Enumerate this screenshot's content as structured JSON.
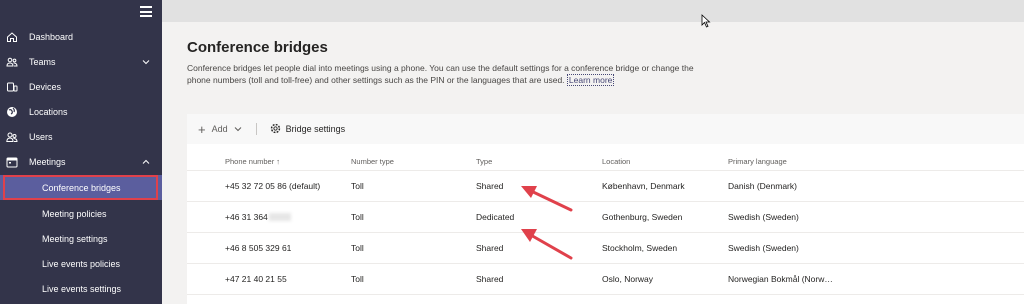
{
  "sidebar": {
    "items": [
      {
        "label": "Dashboard",
        "icon": "home-icon"
      },
      {
        "label": "Teams",
        "icon": "teams-icon"
      },
      {
        "label": "Devices",
        "icon": "devices-icon"
      },
      {
        "label": "Locations",
        "icon": "globe-icon"
      },
      {
        "label": "Users",
        "icon": "users-icon"
      },
      {
        "label": "Meetings",
        "icon": "meetings-icon"
      }
    ],
    "subitems": [
      {
        "label": "Conference bridges"
      },
      {
        "label": "Meeting policies"
      },
      {
        "label": "Meeting settings"
      },
      {
        "label": "Live events policies"
      },
      {
        "label": "Live events settings"
      }
    ]
  },
  "page": {
    "title": "Conference bridges",
    "description": "Conference bridges let people dial into meetings using a phone. You can use the default settings for a conference bridge or change the phone numbers (toll and toll-free) and other settings such as the PIN or the languages that are used.",
    "learn_more": "Learn more"
  },
  "toolbar": {
    "add_label": "Add",
    "bridge_settings_label": "Bridge settings"
  },
  "table": {
    "headers": [
      "Phone number",
      "Number type",
      "Type",
      "Location",
      "Primary language"
    ],
    "rows": [
      {
        "phone": "+45 32 72 05 86 (default)",
        "number_type": "Toll",
        "type": "Shared",
        "location": "København, Denmark",
        "language": "Danish (Denmark)"
      },
      {
        "phone": "+46 31 364",
        "number_type": "Toll",
        "type": "Dedicated",
        "location": "Gothenburg, Sweden",
        "language": "Swedish (Sweden)"
      },
      {
        "phone": "+46 8 505 329 61",
        "number_type": "Toll",
        "type": "Shared",
        "location": "Stockholm, Sweden",
        "language": "Swedish (Sweden)"
      },
      {
        "phone": "+47 21 40 21 55",
        "number_type": "Toll",
        "type": "Shared",
        "location": "Oslo, Norway",
        "language": "Norwegian Bokmål (Norw…"
      }
    ]
  },
  "colors": {
    "sidebar_bg": "#33344a",
    "active_bg": "#5b5e9e",
    "highlight": "#e0414b",
    "accent": "#464775"
  }
}
